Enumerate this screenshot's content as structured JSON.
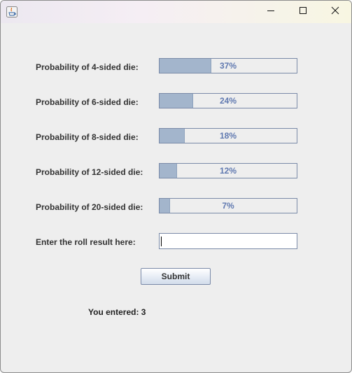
{
  "window": {
    "app_icon": "java-cup-icon",
    "controls": {
      "minimize": "minimize-icon",
      "maximize": "maximize-icon",
      "close": "close-icon"
    }
  },
  "dice": [
    {
      "label": "Probability of 4-sided die:",
      "percent_text": "37%",
      "value": 0.37
    },
    {
      "label": "Probability of 6-sided die:",
      "percent_text": "24%",
      "value": 0.24
    },
    {
      "label": "Probability of 8-sided die:",
      "percent_text": "18%",
      "value": 0.18
    },
    {
      "label": "Probability of 12-sided die:",
      "percent_text": "12%",
      "value": 0.12
    },
    {
      "label": "Probability of 20-sided die:",
      "percent_text": "7%",
      "value": 0.07
    }
  ],
  "input": {
    "label": "Enter the roll result here:",
    "value": ""
  },
  "submit_label": "Submit",
  "result_text": "You entered: 3",
  "colors": {
    "progress_fill": "#a3b5cc",
    "progress_text": "#6079b0",
    "border": "#7a8aa8",
    "background": "#eeeeee"
  }
}
